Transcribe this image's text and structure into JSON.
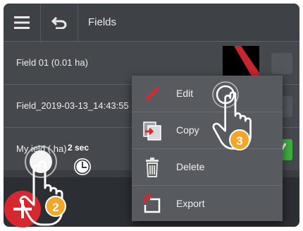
{
  "topbar": {
    "menu_icon": "hamburger-icon",
    "back_icon": "undo-icon",
    "title": "Fields"
  },
  "list": {
    "items": [
      {
        "label": "Field 01 (0.01 ha)"
      },
      {
        "label": "Field_2019-03-13_14:43:55"
      },
      {
        "label": "My    ield (   ha)"
      }
    ]
  },
  "context_menu": {
    "items": [
      {
        "label": "Edit",
        "icon": "pencil-icon"
      },
      {
        "label": "Copy",
        "icon": "copy-icon"
      },
      {
        "label": "Delete",
        "icon": "trash-icon"
      },
      {
        "label": "Export",
        "icon": "export-icon"
      }
    ]
  },
  "fab": {
    "icon": "plus-icon"
  },
  "annotations": {
    "hold_duration": "2 sec",
    "step_2": "2",
    "step_3": "3"
  },
  "colors": {
    "accent_red": "#d6292f",
    "badge_orange": "#f4a62a",
    "check_green": "#3fae3f"
  }
}
